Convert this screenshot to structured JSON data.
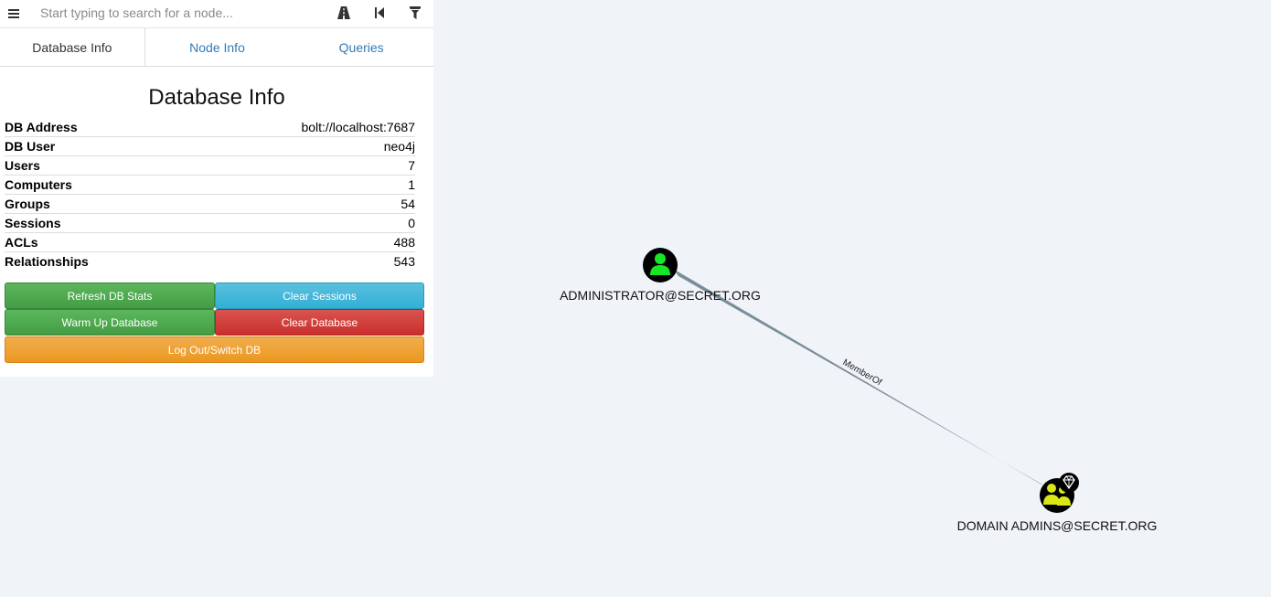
{
  "search": {
    "placeholder": "Start typing to search for a node..."
  },
  "toolbar": {
    "menu_icon": "hamburger-icon",
    "pathfinding_icon": "road-icon",
    "back_icon": "step-backward-icon",
    "filter_icon": "filter-icon"
  },
  "tabs": [
    {
      "label": "Database Info"
    },
    {
      "label": "Node Info"
    },
    {
      "label": "Queries"
    }
  ],
  "db_info": {
    "title": "Database Info",
    "rows": [
      {
        "key": "DB Address",
        "value": "bolt://localhost:7687"
      },
      {
        "key": "DB User",
        "value": "neo4j"
      },
      {
        "key": "Users",
        "value": "7"
      },
      {
        "key": "Computers",
        "value": "1"
      },
      {
        "key": "Groups",
        "value": "54"
      },
      {
        "key": "Sessions",
        "value": "0"
      },
      {
        "key": "ACLs",
        "value": "488"
      },
      {
        "key": "Relationships",
        "value": "543"
      }
    ]
  },
  "buttons": {
    "refresh": "Refresh DB Stats",
    "clear_sessions": "Clear Sessions",
    "warm_up": "Warm Up Database",
    "clear_db": "Clear Database",
    "logout": "Log Out/Switch DB"
  },
  "graph": {
    "nodes": [
      {
        "label": "ADMINISTRATOR@SECRET.ORG",
        "type": "user",
        "icon": "user-icon"
      },
      {
        "label": "DOMAIN ADMINS@SECRET.ORG",
        "type": "group",
        "icon": "group-icon",
        "badge": "high-value-diamond-icon"
      }
    ],
    "edges": [
      {
        "label": "MemberOf"
      }
    ],
    "colors": {
      "user_icon": "#17e625",
      "group_icon": "#dbe617",
      "edge": "#7a8e9a"
    }
  }
}
